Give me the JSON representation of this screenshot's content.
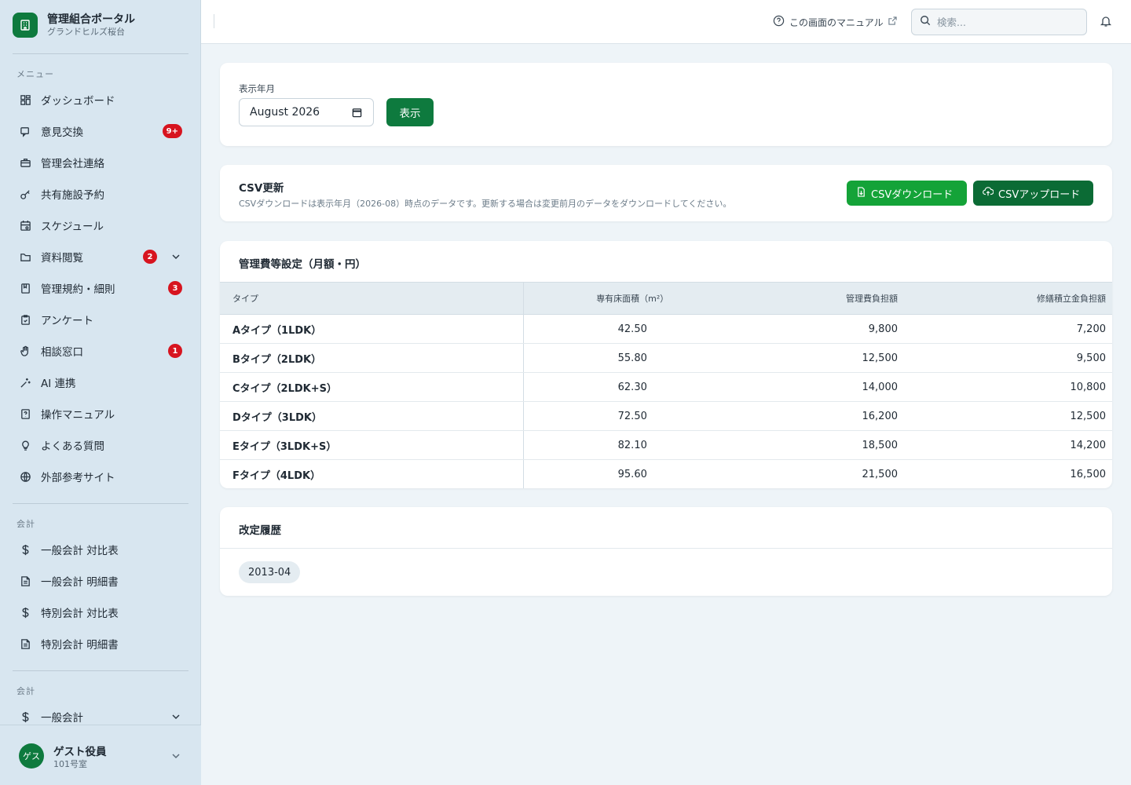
{
  "brand": {
    "title": "管理組合ポータル",
    "subtitle": "グランドヒルズ桜台"
  },
  "sidebar": {
    "menu_label": "メニュー",
    "items": [
      {
        "label": "ダッシュボード",
        "icon": "dashboard-icon"
      },
      {
        "label": "意見交換",
        "icon": "chat-icon",
        "badge": "9+"
      },
      {
        "label": "管理会社連絡",
        "icon": "briefcase-icon"
      },
      {
        "label": "共有施設予約",
        "icon": "key-icon"
      },
      {
        "label": "スケジュール",
        "icon": "calendar-icon"
      },
      {
        "label": "資料閲覧",
        "icon": "folder-icon",
        "badge": "2"
      },
      {
        "label": "管理規約・細則",
        "icon": "book-icon",
        "badge": "3"
      },
      {
        "label": "アンケート",
        "icon": "clipboard-icon"
      },
      {
        "label": "相談窓口",
        "icon": "hand-icon",
        "badge": "1"
      },
      {
        "label": "AI 連携",
        "icon": "sparkle-icon"
      },
      {
        "label": "操作マニュアル",
        "icon": "manual-icon"
      },
      {
        "label": "よくある質問",
        "icon": "lightbulb-icon"
      },
      {
        "label": "外部参考サイト",
        "icon": "globe-icon"
      }
    ],
    "accounting_label": "会計",
    "accounting_items": [
      {
        "label": "一般会計 対比表",
        "icon": "dollar-icon"
      },
      {
        "label": "一般会計 明細書",
        "icon": "document-icon"
      },
      {
        "label": "特別会計 対比表",
        "icon": "dollar-icon"
      },
      {
        "label": "特別会計 明細書",
        "icon": "document-icon"
      }
    ],
    "accounting2_label": "会計",
    "accounting2_items": [
      {
        "label": "一般会計",
        "icon": "dollar-icon"
      }
    ]
  },
  "user": {
    "avatar": "ゲス",
    "name": "ゲスト役員",
    "room": "101号室"
  },
  "header": {
    "manual_link": "この画面のマニュアル",
    "search_placeholder": "検索..."
  },
  "filter": {
    "label": "表示年月",
    "month_value": "August 2026",
    "show_button": "表示"
  },
  "csv": {
    "title": "CSV更新",
    "description": "CSVダウンロードは表示年月（2026-08）時点のデータです。更新する場合は変更前月のデータをダウンロードしてください。",
    "download_button": "CSVダウンロード",
    "upload_button": "CSVアップロード"
  },
  "fees": {
    "title": "管理費等設定（月額・円）",
    "columns": [
      "タイプ",
      "専有床面積（m²）",
      "管理費負担額",
      "修繕積立金負担額"
    ],
    "rows": [
      [
        "Aタイプ（1LDK）",
        "42.50",
        "9,800",
        "7,200"
      ],
      [
        "Bタイプ（2LDK）",
        "55.80",
        "12,500",
        "9,500"
      ],
      [
        "Cタイプ（2LDK+S）",
        "62.30",
        "14,000",
        "10,800"
      ],
      [
        "Dタイプ（3LDK）",
        "72.50",
        "16,200",
        "12,500"
      ],
      [
        "Eタイプ（3LDK+S）",
        "82.10",
        "18,500",
        "14,200"
      ],
      [
        "Fタイプ（4LDK）",
        "95.60",
        "21,500",
        "16,500"
      ]
    ]
  },
  "history": {
    "title": "改定履歴",
    "entries": [
      "2013-04"
    ]
  },
  "colors": {
    "primary": "#0e7a3e",
    "download": "#14a338",
    "upload": "#0b6b35",
    "badge": "#d7141f",
    "sidebar_bg": "#d8e6f0"
  }
}
